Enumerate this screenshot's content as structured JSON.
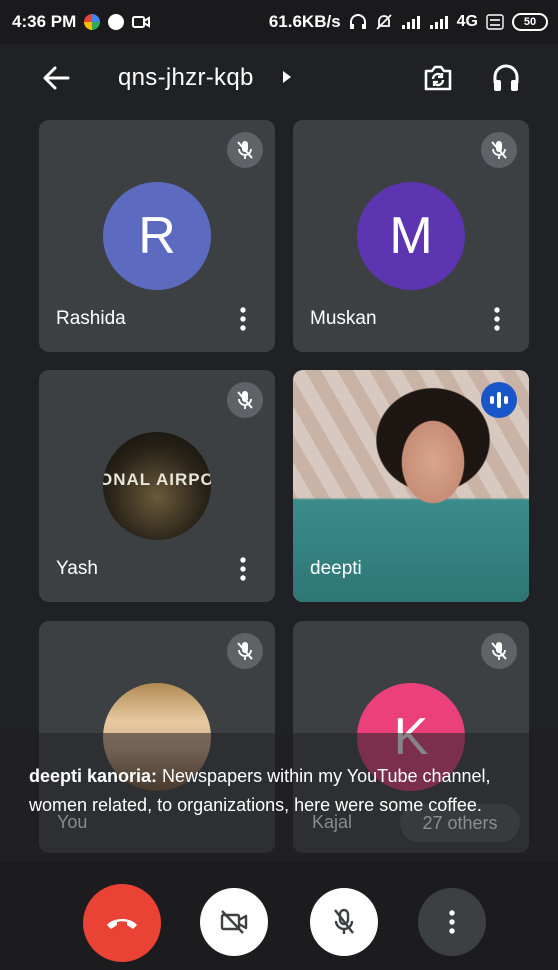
{
  "status_bar": {
    "time": "4:36 PM",
    "speed": "61.6KB/s",
    "network": "4G",
    "battery": "50"
  },
  "header": {
    "meeting_code": "qns-jhzr-kqb"
  },
  "participants": [
    {
      "name": "Rashida",
      "initial": "R",
      "muted": true
    },
    {
      "name": "Muskan",
      "initial": "M",
      "muted": true
    },
    {
      "name": "Yash",
      "initial": "",
      "photo_text": "ONAL AIRPORT",
      "muted": true
    },
    {
      "name": "deepti",
      "initial": "",
      "video_on": true,
      "speaking": true
    },
    {
      "name": "You",
      "initial": "",
      "muted": true
    },
    {
      "name": "Kajal",
      "initial": "K",
      "muted": true
    }
  ],
  "others": "27 others",
  "caption": {
    "speaker": "deepti kanoria:",
    "text": " Newspapers within my YouTube channel, women related, to organizations, here were some coffee."
  },
  "colors": {
    "end_call": "#ea4335",
    "speaking": "#1a56c8",
    "avatar_r": "#5c6bc0",
    "avatar_m": "#5e35b1",
    "avatar_k": "#ec407a"
  }
}
